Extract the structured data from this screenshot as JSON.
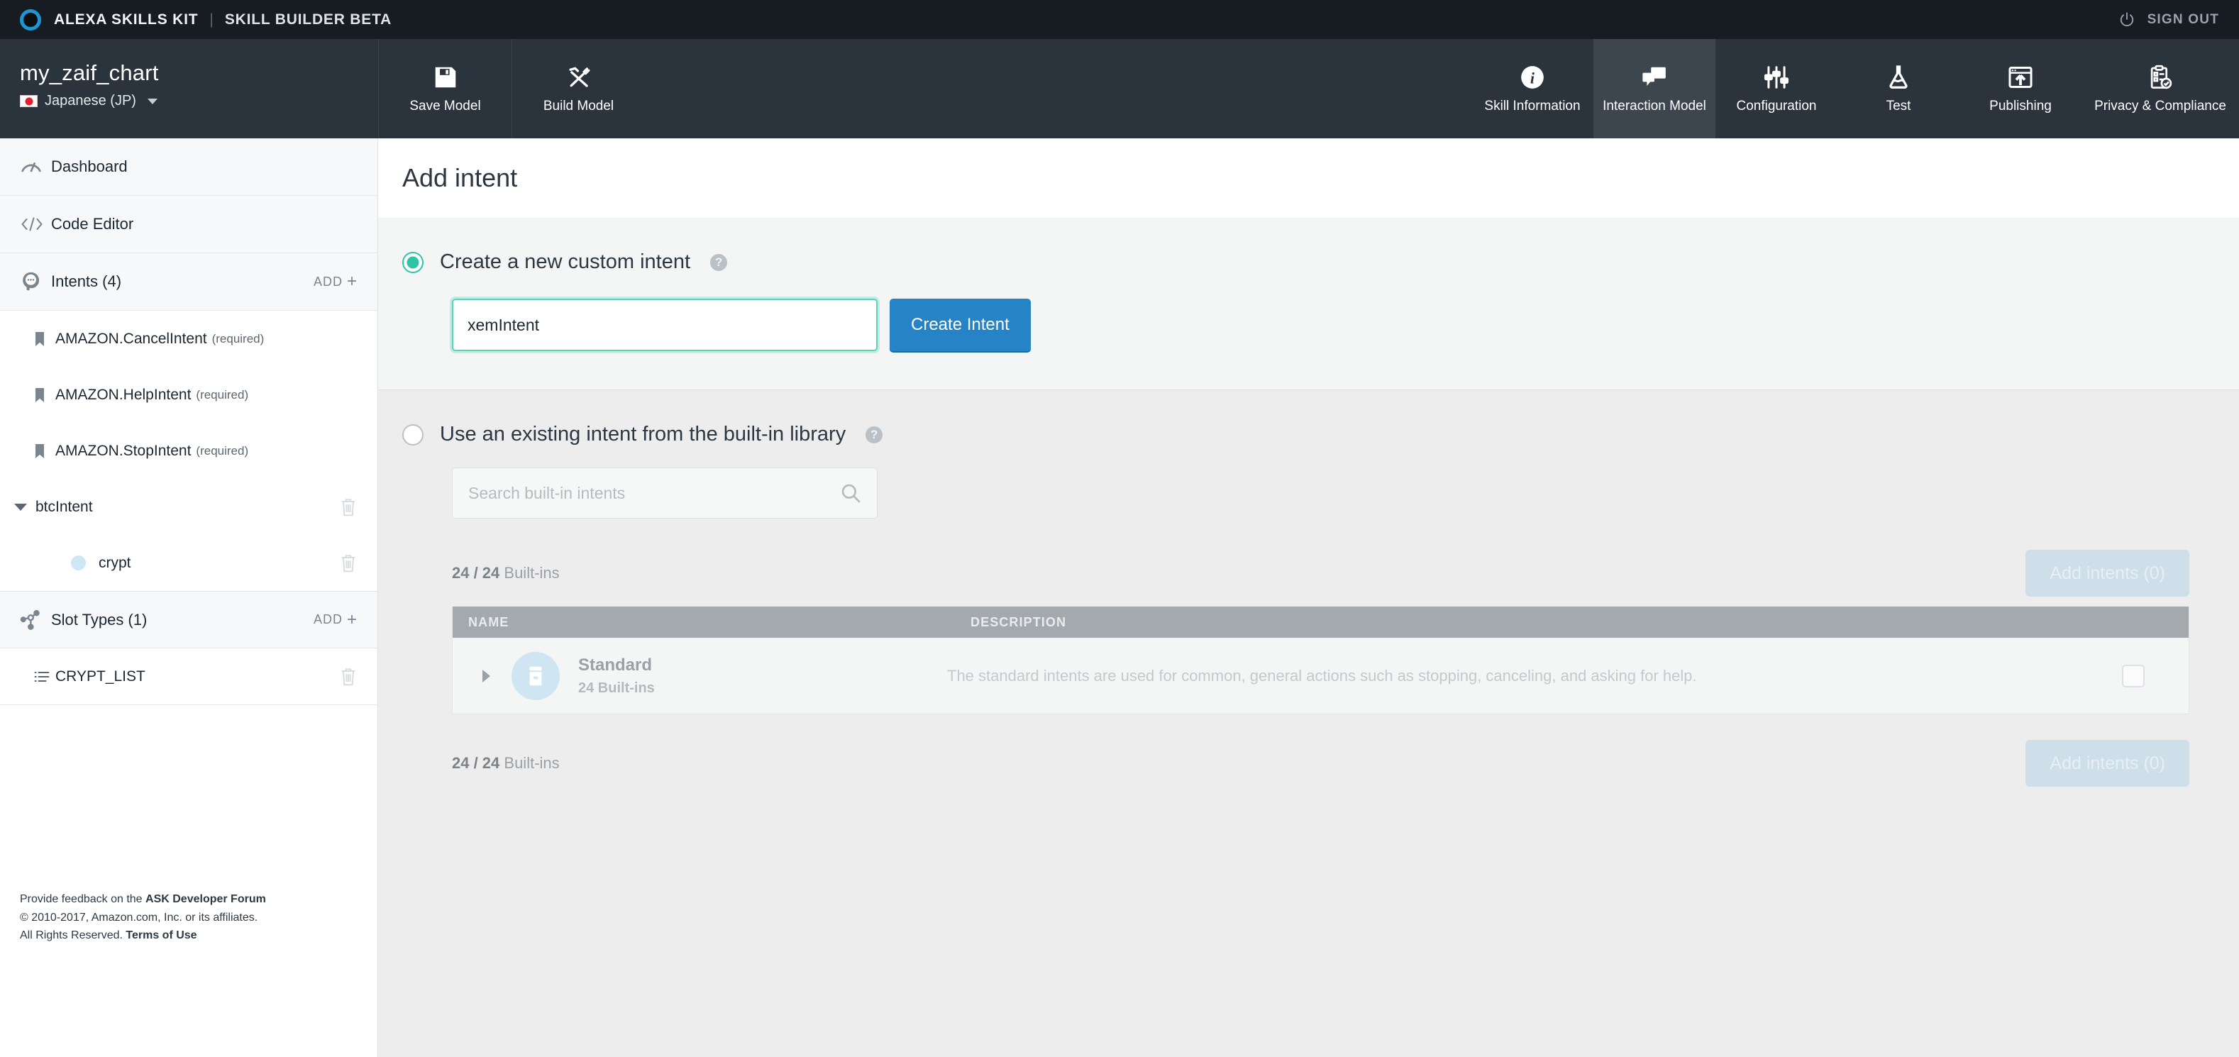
{
  "topbar": {
    "logo_name": "alexa-logo",
    "title": "ALEXA SKILLS KIT",
    "divider": "|",
    "subtitle": "SKILL BUILDER BETA",
    "signout": "SIGN OUT"
  },
  "header": {
    "project_name": "my_zaif_chart",
    "locale": "Japanese (JP)",
    "actions": [
      {
        "label": "Save Model",
        "icon": "floppy-disk-icon"
      },
      {
        "label": "Build Model",
        "icon": "hammer-wrench-icon"
      }
    ],
    "tabs": [
      {
        "label": "Skill Information",
        "icon": "info-icon",
        "active": false
      },
      {
        "label": "Interaction Model",
        "icon": "speech-bubbles-icon",
        "active": true
      },
      {
        "label": "Configuration",
        "icon": "sliders-icon",
        "active": false
      },
      {
        "label": "Test",
        "icon": "flask-icon",
        "active": false
      },
      {
        "label": "Publishing",
        "icon": "upload-window-icon",
        "active": false
      },
      {
        "label": "Privacy & Compliance",
        "icon": "clipboard-check-icon",
        "active": false
      }
    ]
  },
  "sidebar": {
    "dashboard": {
      "label": "Dashboard",
      "icon": "gauge-icon"
    },
    "code_editor": {
      "label": "Code Editor",
      "icon": "code-brackets-icon"
    },
    "intents": {
      "label": "Intents (4)",
      "icon": "intent-head-icon",
      "add_label": "ADD",
      "add_plus": "+"
    },
    "intent_items": [
      {
        "name": "AMAZON.CancelIntent",
        "suffix": "(required)",
        "icon": "bookmark-icon"
      },
      {
        "name": "AMAZON.HelpIntent",
        "suffix": "(required)",
        "icon": "bookmark-icon"
      },
      {
        "name": "AMAZON.StopIntent",
        "suffix": "(required)",
        "icon": "bookmark-icon"
      }
    ],
    "custom_intent": {
      "name": "btcIntent",
      "slot": "crypt"
    },
    "slot_types": {
      "label": "Slot Types (1)",
      "icon": "slot-graph-icon",
      "add_label": "ADD",
      "add_plus": "+"
    },
    "slot_type_items": [
      {
        "name": "CRYPT_LIST",
        "icon": "list-icon"
      }
    ],
    "footer": {
      "line1_prefix": "Provide feedback on the ",
      "line1_link": "ASK Developer Forum",
      "line2": "© 2010-2017, Amazon.com, Inc. or its affiliates.",
      "line3_prefix": "All Rights Reserved. ",
      "line3_link": "Terms of Use"
    }
  },
  "main": {
    "page_title": "Add intent",
    "option_new": {
      "label": "Create a new custom intent",
      "help": "?",
      "selected": true,
      "input_value": "xemIntent",
      "input_placeholder": "",
      "button_label": "Create Intent"
    },
    "option_existing": {
      "label": "Use an existing intent from the built-in library",
      "help": "?",
      "selected": false,
      "search_placeholder": "Search built-in intents",
      "count_bold": "24 / 24",
      "count_rest": " Built-ins",
      "add_button_label": "Add intents (0)",
      "table": {
        "columns": [
          "NAME",
          "DESCRIPTION"
        ],
        "rows": [
          {
            "name": "Standard",
            "sub": "24 Built-ins",
            "description": "The standard intents are used for common, general actions such as stopping, canceling, and asking for help.",
            "checked": false
          }
        ]
      },
      "count_bold_bottom": "24 / 24",
      "count_rest_bottom": " Built-ins",
      "add_button_label_bottom": "Add intents (0)"
    }
  },
  "colors": {
    "topbar_bg": "#161c21",
    "header_bg": "#2b333c",
    "tab_active_bg": "#3d464f",
    "accent_blue": "#2684c6",
    "accent_teal": "#2ec4a6",
    "logo_blue": "#2095d4"
  }
}
